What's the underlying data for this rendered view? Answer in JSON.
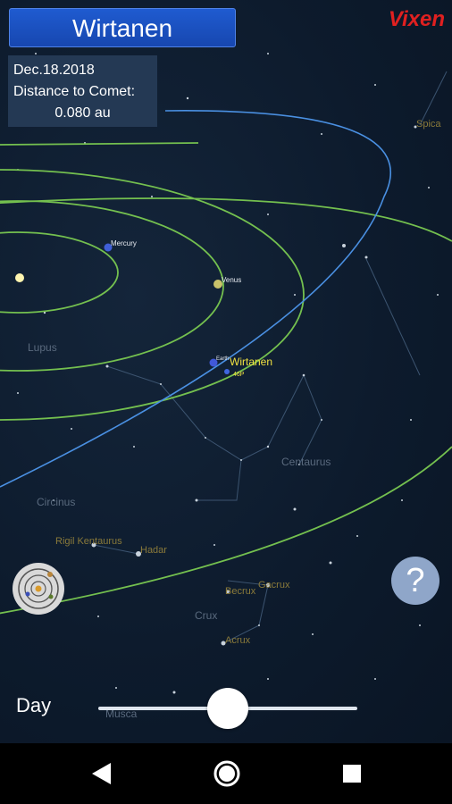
{
  "header": {
    "title": "Wirtanen"
  },
  "info": {
    "date": "Dec.18.2018",
    "distance_label": "Distance to Comet:",
    "distance_value": "0.080 au"
  },
  "brand": {
    "name": "Vixen"
  },
  "planets": {
    "mercury": "Mercury",
    "venus": "Venus",
    "earth": "Earth"
  },
  "comet": {
    "name": "Wirtanen",
    "short": "46P"
  },
  "constellations": {
    "lupus": "Lupus",
    "centaurus": "Centaurus",
    "circinus": "Circinus",
    "rigil": "Rigil Kentaurus",
    "hadar": "Hadar",
    "gacrux": "Gacrux",
    "becrux": "Becrux",
    "crux": "Crux",
    "acrux": "Acrux",
    "musca": "Musca",
    "spica": "Spica"
  },
  "controls": {
    "help_symbol": "?",
    "day_label": "Day"
  },
  "slider": {
    "value_fraction": 0.5
  },
  "colors": {
    "orbit": "#74c04f",
    "comet_orbit": "#4a90e2",
    "title_bg": "#1f5bd0",
    "brand": "#e02020",
    "help_bg": "#8fa6c9"
  },
  "icons": {
    "orbit_view": "solar-system-icon",
    "back": "back-icon",
    "home": "home-icon",
    "recents": "recents-icon"
  }
}
